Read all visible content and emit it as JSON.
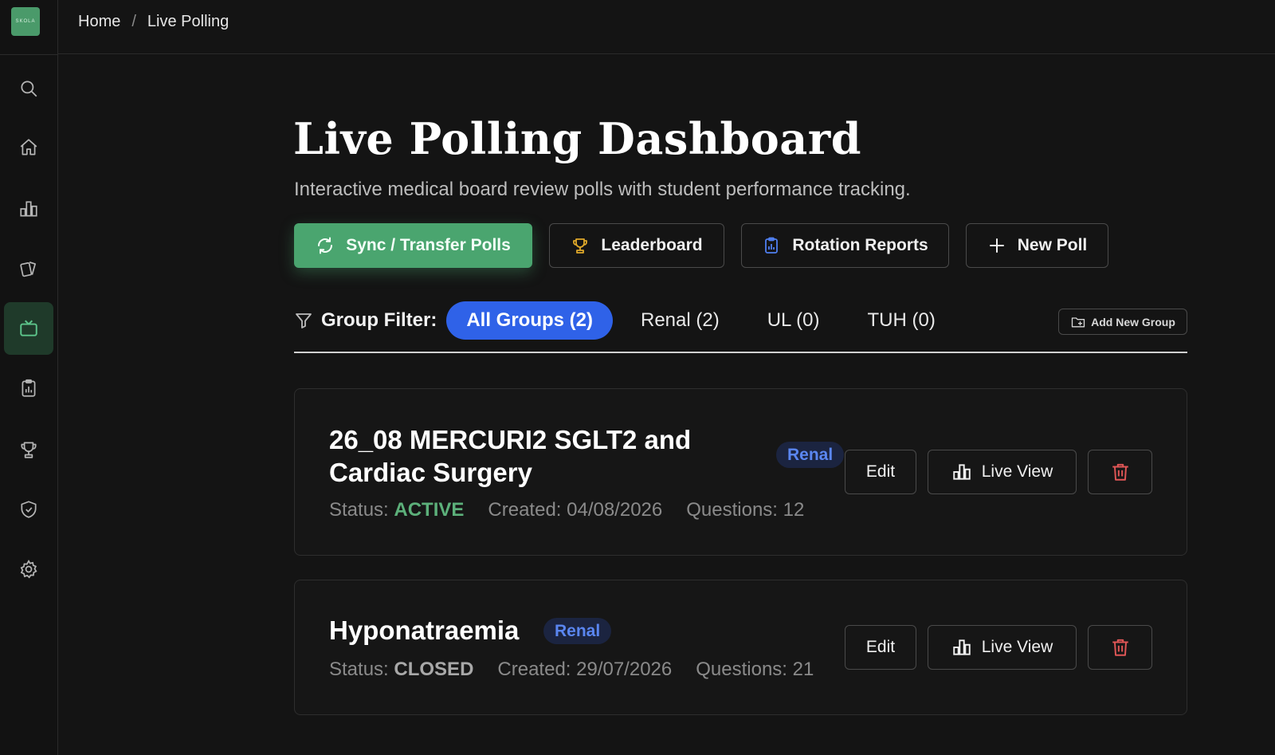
{
  "app": {
    "logo_text": "SKOLA"
  },
  "breadcrumb": {
    "home": "Home",
    "separator": "/",
    "current": "Live Polling"
  },
  "sidebar": {
    "items": [
      {
        "icon": "search-icon",
        "active": false
      },
      {
        "icon": "home-icon",
        "active": false
      },
      {
        "icon": "bar-chart-icon",
        "active": false
      },
      {
        "icon": "cards-icon",
        "active": false
      },
      {
        "icon": "tv-icon",
        "active": true
      },
      {
        "icon": "clipboard-report-icon",
        "active": false
      },
      {
        "icon": "trophy-icon",
        "active": false
      },
      {
        "icon": "shield-icon",
        "active": false
      },
      {
        "icon": "gear-icon",
        "active": false
      }
    ]
  },
  "header": {
    "title": "Live Polling Dashboard",
    "subtitle": "Interactive medical board review polls with student performance tracking."
  },
  "actions": {
    "sync": "Sync / Transfer Polls",
    "leaderboard": "Leaderboard",
    "rotation_reports": "Rotation Reports",
    "new_poll": "New Poll"
  },
  "filter": {
    "label": "Group Filter:",
    "options": [
      "All Groups (2)",
      "Renal (2)",
      "UL (0)",
      "TUH (0)"
    ],
    "selected": "All Groups (2)",
    "add_group": "Add New Group"
  },
  "polls": [
    {
      "title": "26_08 MERCURI2 SGLT2 and Cardiac Surgery",
      "group": "Renal",
      "status_label": "Status:",
      "status": "ACTIVE",
      "created": "Created: 04/08/2026",
      "questions": "Questions: 12",
      "edit": "Edit",
      "live_view": "Live View"
    },
    {
      "title": "Hyponatraemia",
      "group": "Renal",
      "status_label": "Status:",
      "status": "CLOSED",
      "created": "Created: 29/07/2026",
      "questions": "Questions: 21",
      "edit": "Edit",
      "live_view": "Live View"
    }
  ],
  "colors": {
    "accent_green": "#4aa56f",
    "pill_blue": "#2f62e8",
    "badge_blue": "#5a86f0",
    "delete_red": "#e05656",
    "background": "#141414"
  }
}
